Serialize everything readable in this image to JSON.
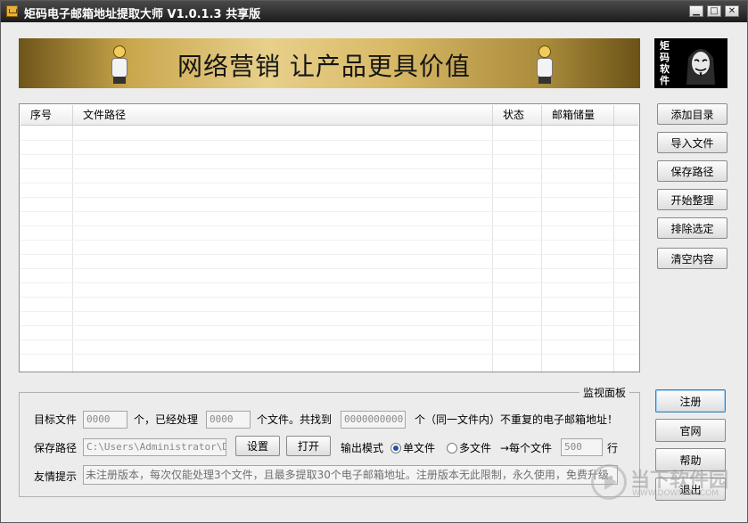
{
  "window": {
    "title": "矩码电子邮箱地址提取大师 V1.0.1.3 共享版",
    "controls": {
      "minimize": "▁",
      "maximize": "□",
      "close": "✕"
    }
  },
  "banner": {
    "slogan": "网络营销  让产品更具价值"
  },
  "logo": {
    "chars": [
      "矩",
      "码",
      "软",
      "件"
    ]
  },
  "table": {
    "columns": [
      "序号",
      "文件路径",
      "状态",
      "邮箱储量"
    ],
    "rows": []
  },
  "side_buttons": {
    "add_dir": "添加目录",
    "import_file": "导入文件",
    "save_path": "保存路径",
    "start": "开始整理",
    "remove_selected": "排除选定",
    "clear": "清空内容"
  },
  "bottom_buttons": {
    "register": "注册",
    "website": "官网",
    "help": "帮助",
    "exit": "退出"
  },
  "panel": {
    "legend": "监视面板",
    "target_file_label": "目标文件",
    "target_file_value": "0000",
    "processed_label": "个，已经处理",
    "processed_value": "0000",
    "found_label": "个文件。共找到",
    "found_value": "0000000000",
    "unique_label": "个（同一文件内）不重复的电子邮箱地址！",
    "save_path_label": "保存路径",
    "save_path_value": "C:\\Users\\Administrator\\Des",
    "settings_button": "设置",
    "open_button": "打开",
    "output_mode_label": "输出模式",
    "single_file": "单文件",
    "multi_file": "多文件",
    "per_file_label": "→每个文件",
    "per_file_value": "500",
    "rows_unit": "行",
    "output_mode_selected": "single",
    "tip_label": "友情提示",
    "tip_text": "未注册版本，每次仅能处理3个文件，且最多提取30个电子邮箱地址。注册版本无此限制，永久使用，免费升级。"
  },
  "watermark": {
    "text": "当下软件园",
    "sub": "WWW.DOWNXIA.COM"
  },
  "colors": {
    "titlebar": "#1c1c1c",
    "accent": "#3c7fb1",
    "banner_gold": "#d8b966"
  }
}
